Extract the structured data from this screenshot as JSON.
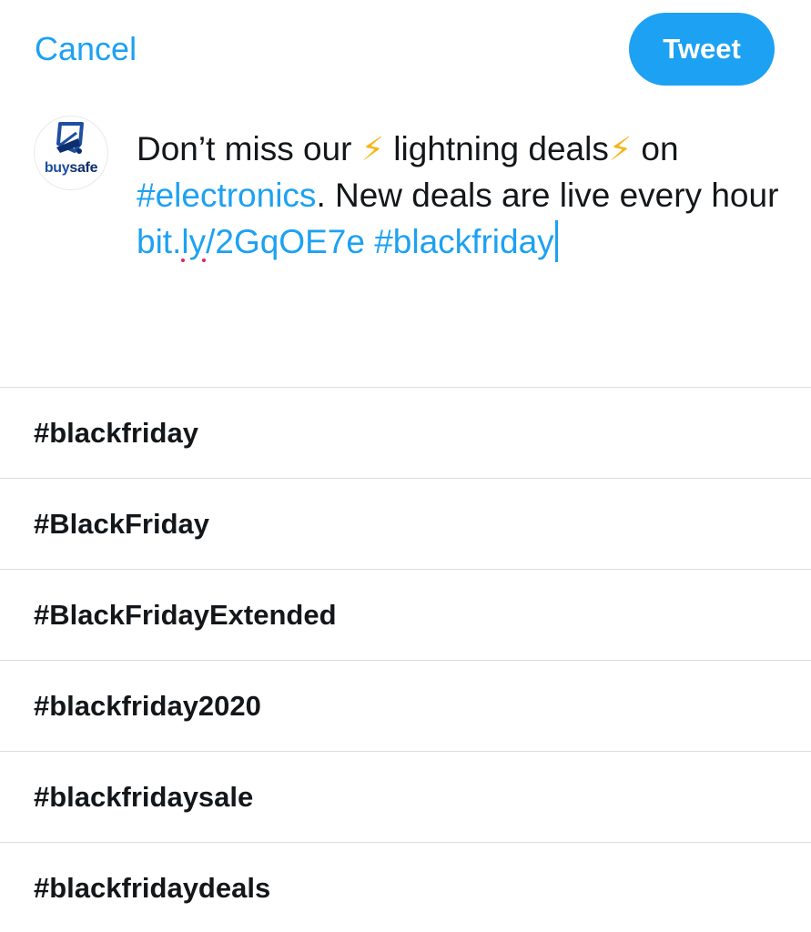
{
  "topbar": {
    "cancel_label": "Cancel",
    "tweet_label": "Tweet"
  },
  "avatar": {
    "brand_part1": "buy",
    "brand_part2": "safe"
  },
  "composer": {
    "segments": [
      {
        "text": "Don’t miss our ",
        "type": "plain"
      },
      {
        "text": "⚡",
        "type": "emoji",
        "icon": "lightning-emoji-icon"
      },
      {
        "text": " lightning deals",
        "type": "plain"
      },
      {
        "text": "⚡",
        "type": "emoji",
        "icon": "lightning-emoji-icon"
      },
      {
        "text": " on ",
        "type": "plain"
      },
      {
        "text": "#electronics",
        "type": "hashtag"
      },
      {
        "text": ". New deals are live every hour ",
        "type": "plain"
      },
      {
        "text": "bit.",
        "type": "link"
      },
      {
        "text": "ly",
        "type": "link-misspelled"
      },
      {
        "text": "/2GqOE7e",
        "type": "link"
      },
      {
        "text": " ",
        "type": "plain"
      },
      {
        "text": "#blackfriday",
        "type": "hashtag"
      }
    ]
  },
  "suggestions": [
    "#blackfriday",
    "#BlackFriday",
    "#BlackFridayExtended",
    "#blackfriday2020",
    "#blackfridaysale",
    "#blackfridaydeals"
  ],
  "colors": {
    "accent": "#1da1f2",
    "text": "#14171a",
    "divider": "#d9dde0",
    "emoji": "#f6b519",
    "spellcheck": "#e0245e"
  }
}
